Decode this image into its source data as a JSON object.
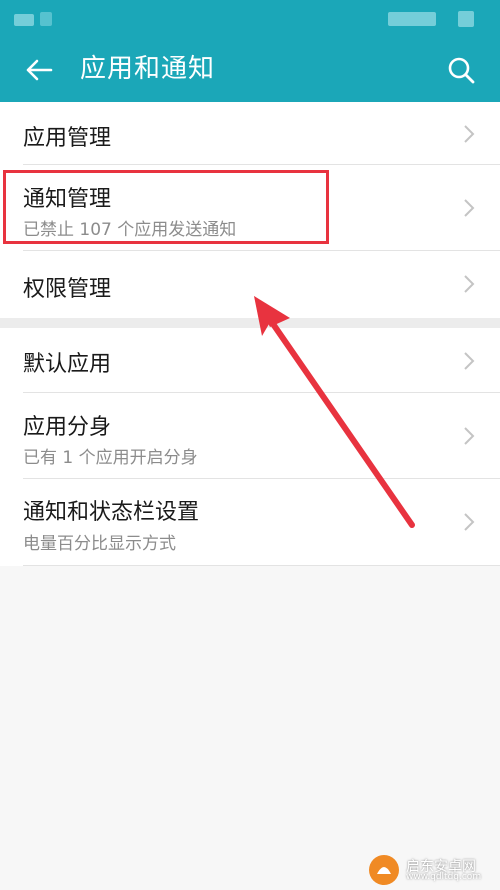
{
  "header": {
    "title": "应用和通知",
    "back_icon": "arrow-left-icon",
    "search_icon": "search-icon",
    "color": "#1ba7b8"
  },
  "group1": [
    {
      "label": "应用管理",
      "sub": ""
    },
    {
      "label": "通知管理",
      "sub": "已禁止 107 个应用发送通知"
    },
    {
      "label": "权限管理",
      "sub": ""
    }
  ],
  "group2": [
    {
      "label": "默认应用",
      "sub": ""
    },
    {
      "label": "应用分身",
      "sub": "已有 1 个应用开启分身"
    },
    {
      "label": "通知和状态栏设置",
      "sub": "电量百分比显示方式"
    }
  ],
  "annotation": {
    "color": "#e8333f"
  },
  "watermark": {
    "name": "启东安卓网",
    "url": "www.qdltdq.com"
  }
}
